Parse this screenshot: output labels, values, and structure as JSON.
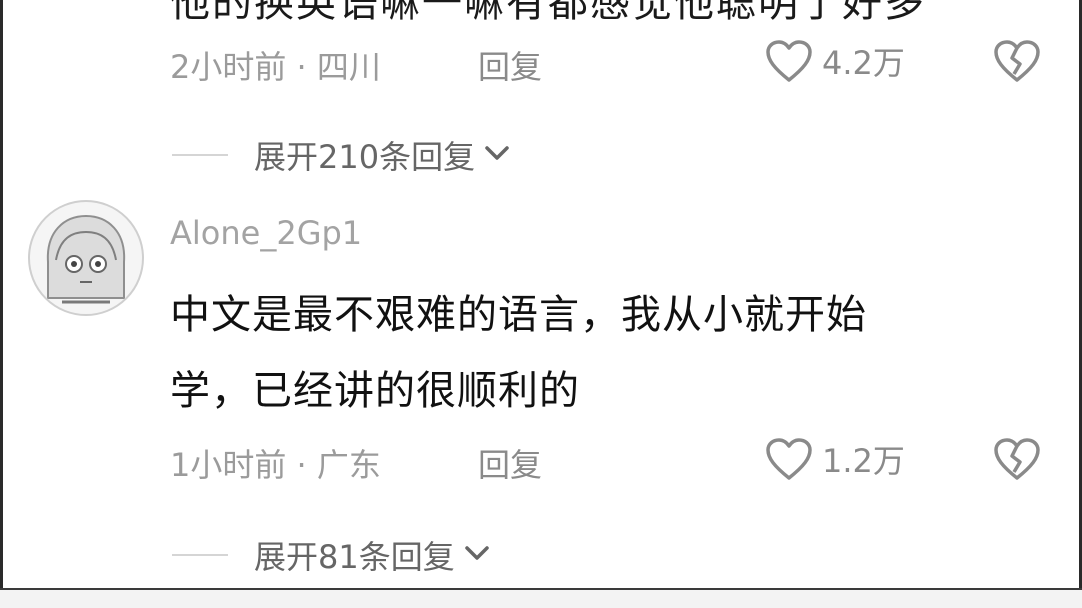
{
  "top_comment": {
    "cut_text": "他的换英语嘛一嘛有都感觉他聪明了好多",
    "meta": "2小时前 · 四川",
    "reply_label": "回复",
    "like_count": "4.2万",
    "expand_label": "展开210条回复"
  },
  "comment": {
    "username": "Alone_2Gp1",
    "text_line1": "中文是最不艰难的语言，我从小就开始",
    "text_line2": "学，已经讲的很顺利的",
    "meta": "1小时前 · 广东",
    "reply_label": "回复",
    "like_count": "1.2万",
    "expand_label": "展开81条回复"
  },
  "icons": {
    "like": "heart-outline-icon",
    "dislike": "broken-heart-icon",
    "expand": "chevron-down-icon"
  },
  "colors": {
    "meta_text": "#9b9b9b",
    "body_text": "#111111",
    "icon_stroke": "#8a8a8a"
  }
}
